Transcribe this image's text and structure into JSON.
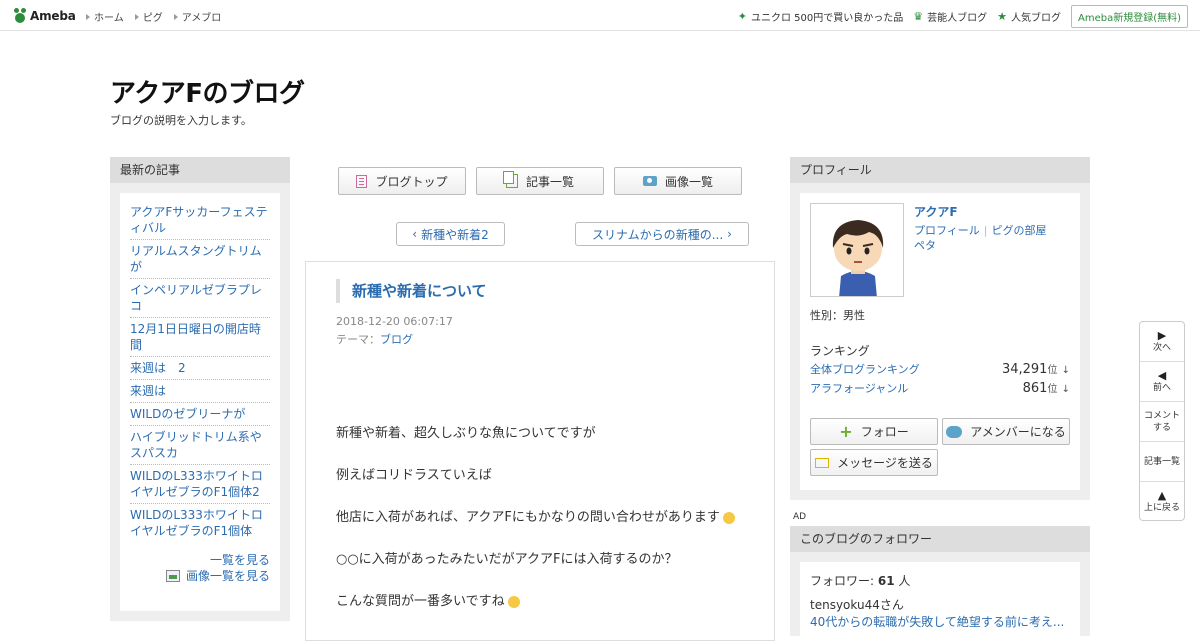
{
  "topbar": {
    "logo": "Ameba",
    "nav": [
      "ホーム",
      "ピグ",
      "アメブロ"
    ],
    "right_items": [
      "ユニクロ 500円で買い良かった品",
      "芸能人ブログ",
      "人気ブログ"
    ],
    "register": "Ameba新規登録(無料)"
  },
  "header": {
    "title": "アクアFのブログ",
    "description": "ブログの説明を入力します。"
  },
  "left": {
    "heading": "最新の記事",
    "items": [
      "アクアFサッカーフェスティバル",
      "リアルムスタングトリムが",
      "インペリアルゼブラプレコ",
      "12月1日日曜日の開店時間",
      "来週は　2",
      "来週は",
      "WILDのゼブリーナが",
      "ハイブリッドトリム系やスパスカ",
      "WILDのL333ホワイトロイヤルゼブラのF1個体2",
      "WILDのL333ホワイトロイヤルゼブラのF1個体"
    ],
    "more": "一覧を見る",
    "images_more": "画像一覧を見る"
  },
  "tabs": [
    "ブログトップ",
    "記事一覧",
    "画像一覧"
  ],
  "pager": {
    "prev": "新種や新着2",
    "next": "スリナムからの新種の..."
  },
  "article": {
    "title": "新種や新着について",
    "date": "2018-12-20 06:07:17",
    "theme_label": "テーマ：",
    "theme": "ブログ",
    "paragraphs": [
      "新種や新着、超久しぶりな魚についてですが",
      "例えばコリドラスていえば",
      "他店に入荷があれば、アクアFにもかなりの問い合わせがあります",
      "○○に入荷があったみたいだがアクアFには入荷するのか？",
      "こんな質問が一番多いですね"
    ]
  },
  "profile": {
    "heading": "プロフィール",
    "name": "アクアF",
    "link1": "プロフィール",
    "link2": "ピグの部屋",
    "link3": "ペタ",
    "gender": "性別：男性",
    "ranking_title": "ランキング",
    "rank1_label": "全体ブログランキング",
    "rank1_value": "34,291",
    "rank2_label": "アラフォージャンル",
    "rank2_value": "861",
    "rank_unit": "位",
    "rank_arrow": "↓",
    "follow": "フォロー",
    "member": "アメンバーになる",
    "message": "メッセージを送る"
  },
  "ad_label": "AD",
  "followers": {
    "heading": "このブログのフォロワー",
    "count_label": "フォロワー: ",
    "count": "61",
    "count_unit": " 人",
    "user": "tensyoku44さん",
    "link": "40代からの転職が失敗して絶望する前に考え..."
  },
  "floatnav": {
    "next": "次へ",
    "prev": "前へ",
    "comment": "コメントする",
    "list": "記事一覧",
    "top": "上に戻る"
  },
  "colors": {
    "link": "#2b6cb0",
    "brand_green": "#2d8c3c",
    "side_bg": "#eeeeee"
  }
}
